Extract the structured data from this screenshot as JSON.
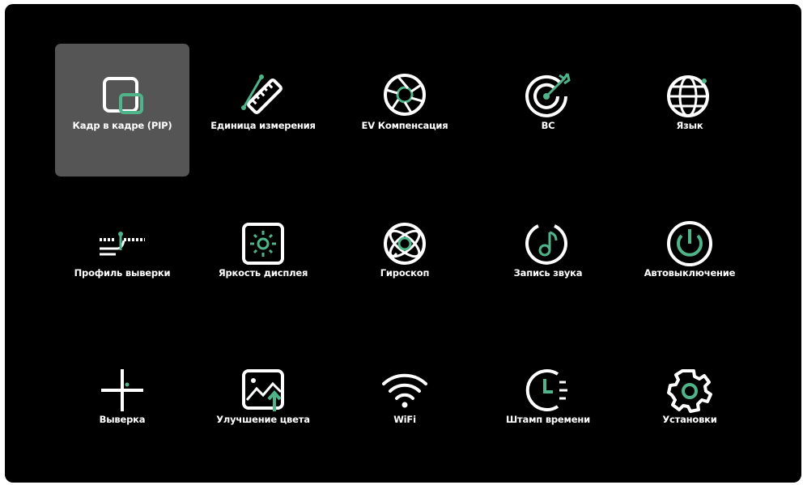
{
  "colors": {
    "background": "#000000",
    "selected_tile": "#555555",
    "icon_primary": "#ffffff",
    "accent": "#4fb48a"
  },
  "menu": {
    "selected_index": 0,
    "items": [
      {
        "label": "Кадр в кадре (PIP)",
        "icon": "pip-icon"
      },
      {
        "label": "Единица измерения",
        "icon": "ruler-icon"
      },
      {
        "label": "EV Компенсация",
        "icon": "aperture-icon"
      },
      {
        "label": "BC",
        "icon": "target-icon"
      },
      {
        "label": "Язык",
        "icon": "globe-icon"
      },
      {
        "label": "Профиль выверки",
        "icon": "zeroing-profile-icon"
      },
      {
        "label": "Яркость дисплея",
        "icon": "brightness-icon"
      },
      {
        "label": "Гироскоп",
        "icon": "gyroscope-icon"
      },
      {
        "label": "Запись звука",
        "icon": "audio-record-icon"
      },
      {
        "label": "Автовыключение",
        "icon": "power-icon"
      },
      {
        "label": "Выверка",
        "icon": "crosshair-icon"
      },
      {
        "label": "Улучшение цвета",
        "icon": "color-enhance-icon"
      },
      {
        "label": "WiFi",
        "icon": "wifi-icon"
      },
      {
        "label": "Штамп времени",
        "icon": "timestamp-icon"
      },
      {
        "label": "Установки",
        "icon": "settings-gear-icon"
      }
    ]
  }
}
